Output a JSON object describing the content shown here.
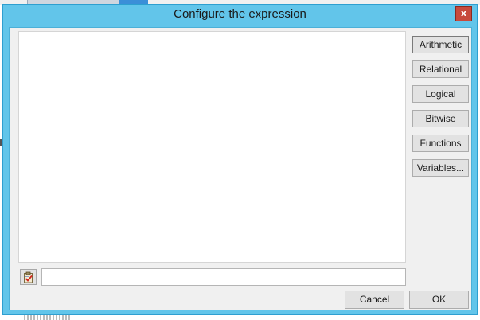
{
  "dialog": {
    "title": "Configure the expression",
    "close_label": "x"
  },
  "operators": {
    "arithmetic": "Arithmetic",
    "relational": "Relational",
    "logical": "Logical",
    "bitwise": "Bitwise",
    "functions": "Functions",
    "variables": "Variables..."
  },
  "expression": {
    "text": "",
    "input_value": ""
  },
  "footer": {
    "cancel": "Cancel",
    "ok": "OK"
  },
  "colors": {
    "frame": "#62c5ea",
    "close": "#c74a3c",
    "client": "#f0f0f0",
    "button": "#e2e2e2"
  },
  "icons": {
    "validate": "clipboard-check-icon"
  }
}
